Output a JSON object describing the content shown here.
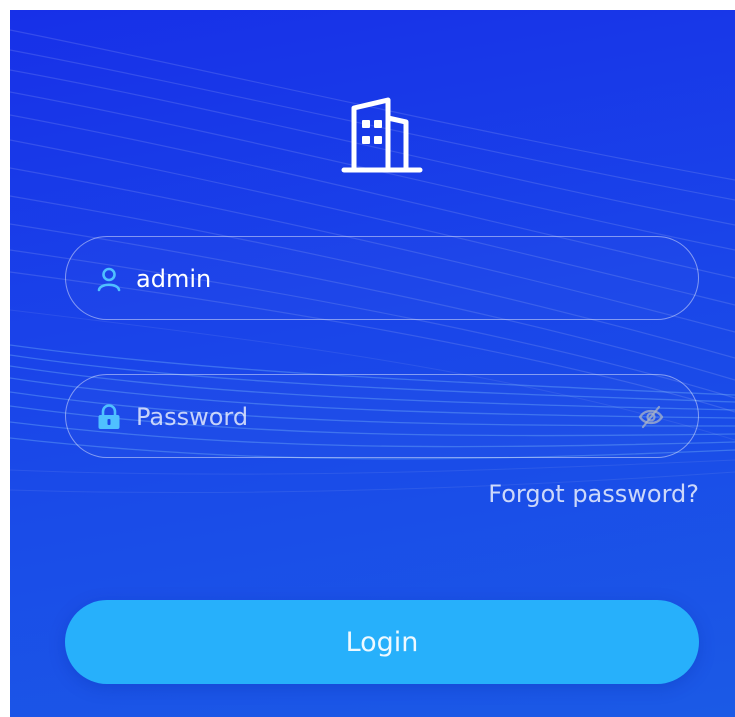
{
  "icons": {
    "logo": "building-icon",
    "username": "user-icon",
    "password": "lock-icon",
    "toggle_visibility": "eye-off-icon"
  },
  "login_form": {
    "username": {
      "value": "admin",
      "placeholder": ""
    },
    "password": {
      "value": "",
      "placeholder": "Password"
    },
    "forgot_password_label": "Forgot password?",
    "login_button_label": "Login"
  },
  "colors": {
    "background": "#1a40e9",
    "accent_icon": "#4fc0ff",
    "button": "#27b0fb",
    "logo": "#ffffff"
  }
}
